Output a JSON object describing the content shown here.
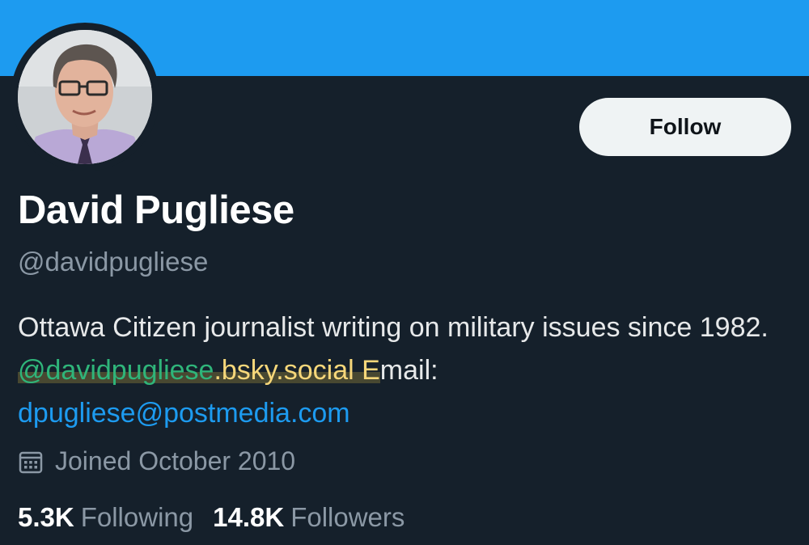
{
  "colors": {
    "banner": "#1d9bf0",
    "background": "#15202b",
    "link": "#1d9bf0",
    "muted": "#8b98a5"
  },
  "profile": {
    "name": "David Pugliese",
    "handle": "@davidpugliese",
    "follow_label": "Follow",
    "bio": {
      "line1": "Ottawa Citizen journalist writing on military issues since 1982.",
      "bluesky_handle": "@davidpugliese",
      "bluesky_domain": ".bsky.social",
      "bluesky_tail": " E",
      "email_label": "mail:",
      "email": "dpugliese@postmedia.com"
    },
    "joined_icon": "calendar-icon",
    "joined": "Joined October 2010",
    "stats": {
      "following_count": "5.3K",
      "following_label": "Following",
      "followers_count": "14.8K",
      "followers_label": "Followers"
    }
  }
}
